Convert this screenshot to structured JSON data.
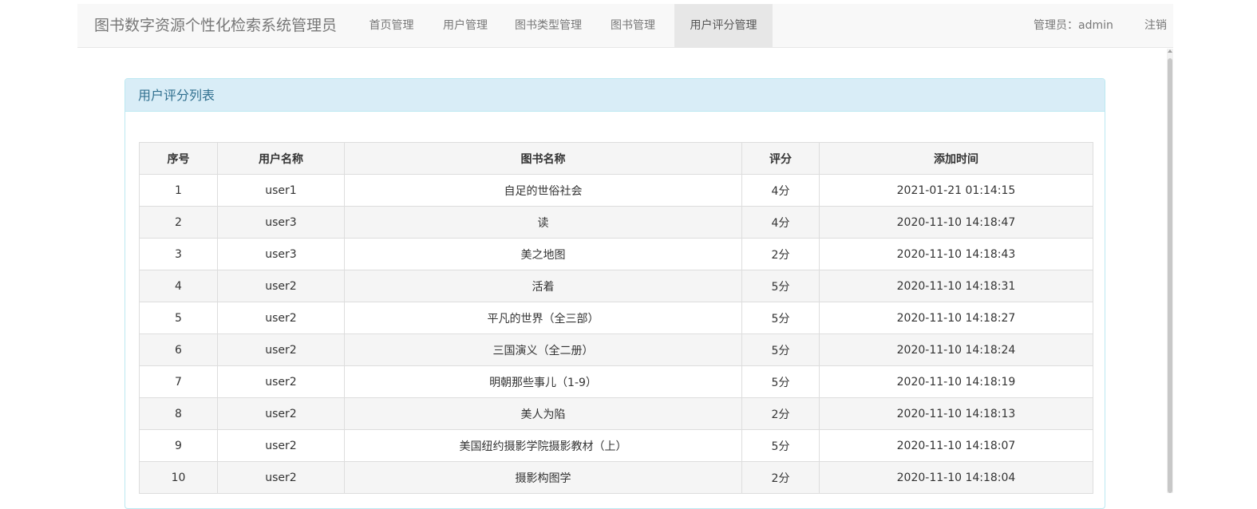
{
  "navbar": {
    "brand": "图书数字资源个性化检索系统管理员",
    "items": [
      {
        "label": "首页管理",
        "active": false
      },
      {
        "label": "用户管理",
        "active": false
      },
      {
        "label": "图书类型管理",
        "active": false
      },
      {
        "label": "图书管理",
        "active": false
      },
      {
        "label": "用户评分管理",
        "active": true
      }
    ],
    "admin_label": "管理员：admin",
    "logout_label": "注销"
  },
  "panel": {
    "title": "用户评分列表"
  },
  "table": {
    "headers": [
      "序号",
      "用户名称",
      "图书名称",
      "评分",
      "添加时间"
    ],
    "rows": [
      [
        "1",
        "user1",
        "自足的世俗社会",
        "4分",
        "2021-01-21 01:14:15"
      ],
      [
        "2",
        "user3",
        "读",
        "4分",
        "2020-11-10 14:18:47"
      ],
      [
        "3",
        "user3",
        "美之地图",
        "2分",
        "2020-11-10 14:18:43"
      ],
      [
        "4",
        "user2",
        "活着",
        "5分",
        "2020-11-10 14:18:31"
      ],
      [
        "5",
        "user2",
        "平凡的世界（全三部）",
        "5分",
        "2020-11-10 14:18:27"
      ],
      [
        "6",
        "user2",
        "三国演义（全二册）",
        "5分",
        "2020-11-10 14:18:24"
      ],
      [
        "7",
        "user2",
        "明朝那些事儿（1-9）",
        "5分",
        "2020-11-10 14:18:19"
      ],
      [
        "8",
        "user2",
        "美人为陷",
        "2分",
        "2020-11-10 14:18:13"
      ],
      [
        "9",
        "user2",
        "美国纽约摄影学院摄影教材（上）",
        "5分",
        "2020-11-10 14:18:07"
      ],
      [
        "10",
        "user2",
        "摄影构图学",
        "2分",
        "2020-11-10 14:18:04"
      ]
    ]
  },
  "colors": {
    "navbar_bg": "#f8f8f8",
    "nav_active_bg": "#e7e7e7",
    "panel_heading_bg": "#d9edf7",
    "panel_heading_text": "#31708f",
    "panel_border": "#bce8f1",
    "table_stripe": "#f5f5f5"
  }
}
